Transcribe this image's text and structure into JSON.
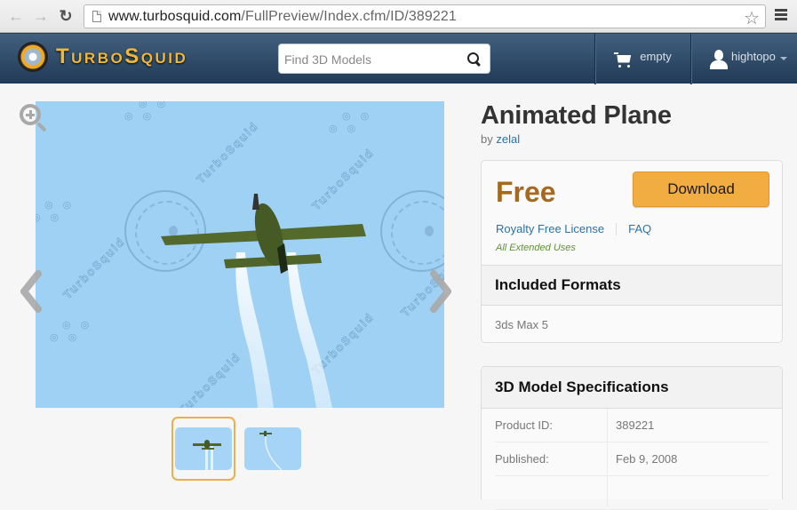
{
  "browser": {
    "url_host": "www.turbosquid.com",
    "url_path": "/FullPreview/Index.cfm/ID/389221",
    "back_icon": "arrow-left-icon",
    "forward_icon": "arrow-right-icon",
    "reload_icon": "reload-icon",
    "bookmark_icon": "star-icon",
    "menu_icon": "hamburger-menu-icon"
  },
  "header": {
    "brand": "TurboSquid",
    "search_placeholder": "Find 3D Models",
    "cart_label": "empty",
    "user_label": "hightopo"
  },
  "viewer": {
    "watermark_text": "TurboSquid",
    "thumbnails": [
      {
        "label": "Plane front view",
        "selected": true
      },
      {
        "label": "Plane distant view",
        "selected": false
      }
    ]
  },
  "product": {
    "title": "Animated Plane",
    "by_prefix": "by",
    "author": "zelal",
    "price": "Free",
    "download_label": "Download",
    "license_link": "Royalty Free License",
    "faq_link": "FAQ",
    "extended_uses": "All Extended Uses",
    "formats_heading": "Included Formats",
    "formats": [
      "3ds Max 5"
    ],
    "specs_heading": "3D Model Specifications",
    "specs": [
      {
        "key": "Product ID:",
        "value": "389221"
      },
      {
        "key": "Published:",
        "value": "Feb 9, 2008"
      }
    ]
  },
  "colors": {
    "header_bg": "#2f4a68",
    "accent_orange": "#f1ac42",
    "price_brown": "#a56a1e",
    "link_blue": "#2c72a6",
    "sky_blue": "#9fd1f5"
  }
}
